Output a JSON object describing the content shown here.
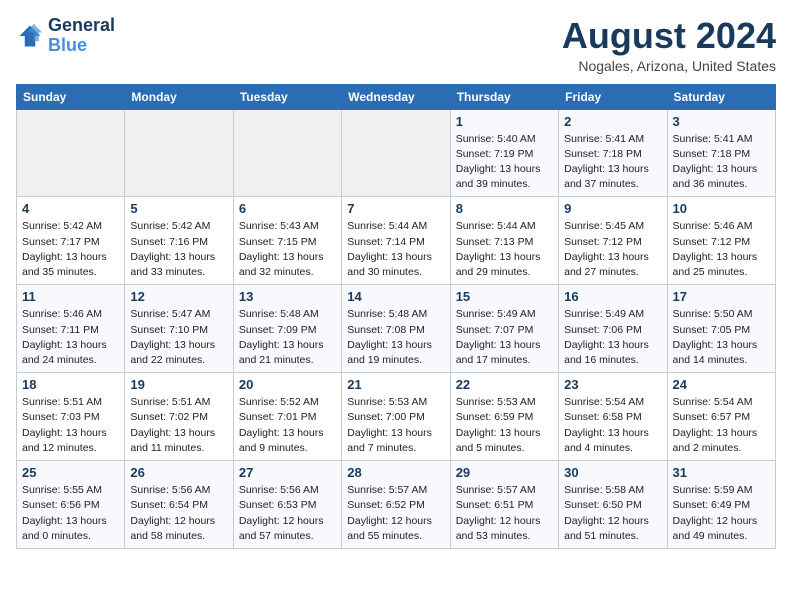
{
  "logo": {
    "line1": "General",
    "line2": "Blue"
  },
  "header": {
    "title": "August 2024",
    "location": "Nogales, Arizona, United States"
  },
  "weekdays": [
    "Sunday",
    "Monday",
    "Tuesday",
    "Wednesday",
    "Thursday",
    "Friday",
    "Saturday"
  ],
  "weeks": [
    [
      {
        "day": "",
        "sunrise": "",
        "sunset": "",
        "daylight": ""
      },
      {
        "day": "",
        "sunrise": "",
        "sunset": "",
        "daylight": ""
      },
      {
        "day": "",
        "sunrise": "",
        "sunset": "",
        "daylight": ""
      },
      {
        "day": "",
        "sunrise": "",
        "sunset": "",
        "daylight": ""
      },
      {
        "day": "1",
        "sunrise": "Sunrise: 5:40 AM",
        "sunset": "Sunset: 7:19 PM",
        "daylight": "Daylight: 13 hours and 39 minutes."
      },
      {
        "day": "2",
        "sunrise": "Sunrise: 5:41 AM",
        "sunset": "Sunset: 7:18 PM",
        "daylight": "Daylight: 13 hours and 37 minutes."
      },
      {
        "day": "3",
        "sunrise": "Sunrise: 5:41 AM",
        "sunset": "Sunset: 7:18 PM",
        "daylight": "Daylight: 13 hours and 36 minutes."
      }
    ],
    [
      {
        "day": "4",
        "sunrise": "Sunrise: 5:42 AM",
        "sunset": "Sunset: 7:17 PM",
        "daylight": "Daylight: 13 hours and 35 minutes."
      },
      {
        "day": "5",
        "sunrise": "Sunrise: 5:42 AM",
        "sunset": "Sunset: 7:16 PM",
        "daylight": "Daylight: 13 hours and 33 minutes."
      },
      {
        "day": "6",
        "sunrise": "Sunrise: 5:43 AM",
        "sunset": "Sunset: 7:15 PM",
        "daylight": "Daylight: 13 hours and 32 minutes."
      },
      {
        "day": "7",
        "sunrise": "Sunrise: 5:44 AM",
        "sunset": "Sunset: 7:14 PM",
        "daylight": "Daylight: 13 hours and 30 minutes."
      },
      {
        "day": "8",
        "sunrise": "Sunrise: 5:44 AM",
        "sunset": "Sunset: 7:13 PM",
        "daylight": "Daylight: 13 hours and 29 minutes."
      },
      {
        "day": "9",
        "sunrise": "Sunrise: 5:45 AM",
        "sunset": "Sunset: 7:12 PM",
        "daylight": "Daylight: 13 hours and 27 minutes."
      },
      {
        "day": "10",
        "sunrise": "Sunrise: 5:46 AM",
        "sunset": "Sunset: 7:12 PM",
        "daylight": "Daylight: 13 hours and 25 minutes."
      }
    ],
    [
      {
        "day": "11",
        "sunrise": "Sunrise: 5:46 AM",
        "sunset": "Sunset: 7:11 PM",
        "daylight": "Daylight: 13 hours and 24 minutes."
      },
      {
        "day": "12",
        "sunrise": "Sunrise: 5:47 AM",
        "sunset": "Sunset: 7:10 PM",
        "daylight": "Daylight: 13 hours and 22 minutes."
      },
      {
        "day": "13",
        "sunrise": "Sunrise: 5:48 AM",
        "sunset": "Sunset: 7:09 PM",
        "daylight": "Daylight: 13 hours and 21 minutes."
      },
      {
        "day": "14",
        "sunrise": "Sunrise: 5:48 AM",
        "sunset": "Sunset: 7:08 PM",
        "daylight": "Daylight: 13 hours and 19 minutes."
      },
      {
        "day": "15",
        "sunrise": "Sunrise: 5:49 AM",
        "sunset": "Sunset: 7:07 PM",
        "daylight": "Daylight: 13 hours and 17 minutes."
      },
      {
        "day": "16",
        "sunrise": "Sunrise: 5:49 AM",
        "sunset": "Sunset: 7:06 PM",
        "daylight": "Daylight: 13 hours and 16 minutes."
      },
      {
        "day": "17",
        "sunrise": "Sunrise: 5:50 AM",
        "sunset": "Sunset: 7:05 PM",
        "daylight": "Daylight: 13 hours and 14 minutes."
      }
    ],
    [
      {
        "day": "18",
        "sunrise": "Sunrise: 5:51 AM",
        "sunset": "Sunset: 7:03 PM",
        "daylight": "Daylight: 13 hours and 12 minutes."
      },
      {
        "day": "19",
        "sunrise": "Sunrise: 5:51 AM",
        "sunset": "Sunset: 7:02 PM",
        "daylight": "Daylight: 13 hours and 11 minutes."
      },
      {
        "day": "20",
        "sunrise": "Sunrise: 5:52 AM",
        "sunset": "Sunset: 7:01 PM",
        "daylight": "Daylight: 13 hours and 9 minutes."
      },
      {
        "day": "21",
        "sunrise": "Sunrise: 5:53 AM",
        "sunset": "Sunset: 7:00 PM",
        "daylight": "Daylight: 13 hours and 7 minutes."
      },
      {
        "day": "22",
        "sunrise": "Sunrise: 5:53 AM",
        "sunset": "Sunset: 6:59 PM",
        "daylight": "Daylight: 13 hours and 5 minutes."
      },
      {
        "day": "23",
        "sunrise": "Sunrise: 5:54 AM",
        "sunset": "Sunset: 6:58 PM",
        "daylight": "Daylight: 13 hours and 4 minutes."
      },
      {
        "day": "24",
        "sunrise": "Sunrise: 5:54 AM",
        "sunset": "Sunset: 6:57 PM",
        "daylight": "Daylight: 13 hours and 2 minutes."
      }
    ],
    [
      {
        "day": "25",
        "sunrise": "Sunrise: 5:55 AM",
        "sunset": "Sunset: 6:56 PM",
        "daylight": "Daylight: 13 hours and 0 minutes."
      },
      {
        "day": "26",
        "sunrise": "Sunrise: 5:56 AM",
        "sunset": "Sunset: 6:54 PM",
        "daylight": "Daylight: 12 hours and 58 minutes."
      },
      {
        "day": "27",
        "sunrise": "Sunrise: 5:56 AM",
        "sunset": "Sunset: 6:53 PM",
        "daylight": "Daylight: 12 hours and 57 minutes."
      },
      {
        "day": "28",
        "sunrise": "Sunrise: 5:57 AM",
        "sunset": "Sunset: 6:52 PM",
        "daylight": "Daylight: 12 hours and 55 minutes."
      },
      {
        "day": "29",
        "sunrise": "Sunrise: 5:57 AM",
        "sunset": "Sunset: 6:51 PM",
        "daylight": "Daylight: 12 hours and 53 minutes."
      },
      {
        "day": "30",
        "sunrise": "Sunrise: 5:58 AM",
        "sunset": "Sunset: 6:50 PM",
        "daylight": "Daylight: 12 hours and 51 minutes."
      },
      {
        "day": "31",
        "sunrise": "Sunrise: 5:59 AM",
        "sunset": "Sunset: 6:49 PM",
        "daylight": "Daylight: 12 hours and 49 minutes."
      }
    ]
  ]
}
